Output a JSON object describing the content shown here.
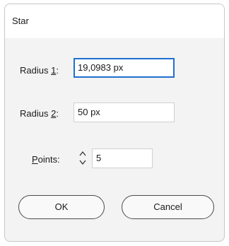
{
  "window": {
    "title": "Star"
  },
  "fields": {
    "radius1": {
      "label_pre": "Radius ",
      "label_ul": "1",
      "label_post": ":",
      "value": "19,0983 px"
    },
    "radius2": {
      "label_pre": "Radius ",
      "label_ul": "2",
      "label_post": ":",
      "value": "50 px"
    },
    "points": {
      "label_pre": "",
      "label_ul": "P",
      "label_post": "oints:",
      "value": "5"
    }
  },
  "buttons": {
    "ok": "OK",
    "cancel": "Cancel"
  },
  "icons": {
    "spinner_up": "chevron-up-icon",
    "spinner_down": "chevron-down-icon"
  },
  "colors": {
    "focus_border": "#1f6fd0",
    "dialog_bg": "#f3f3f3",
    "title_bg": "#ffffff"
  }
}
